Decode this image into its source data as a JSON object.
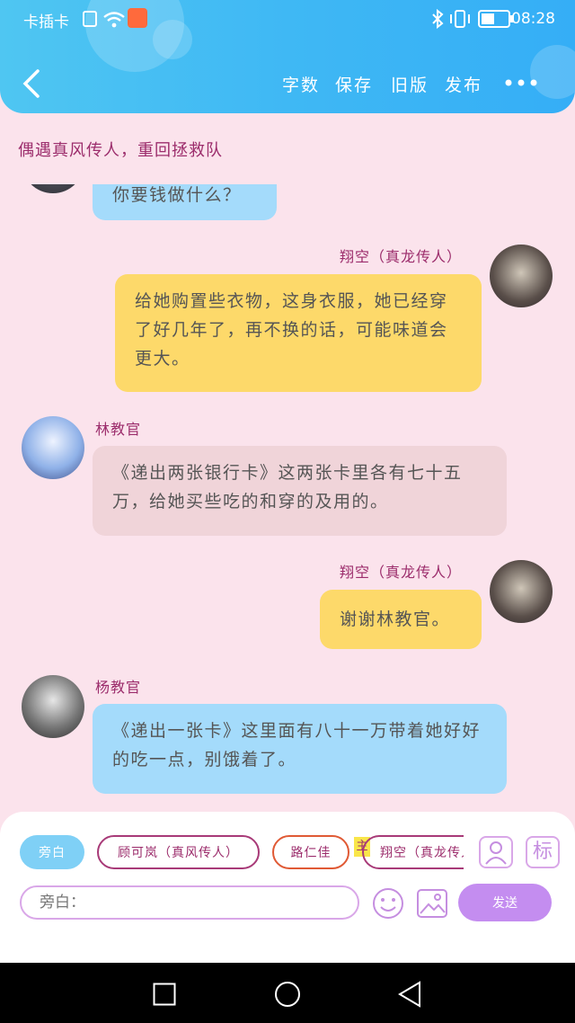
{
  "status": {
    "carrier": "卡插卡",
    "time": "08:28"
  },
  "header": {
    "actions": [
      "字数",
      "保存",
      "旧版",
      "发布"
    ]
  },
  "story": {
    "title": "偶遇真风传人，重回拯救队"
  },
  "messages": [
    {
      "name": "",
      "text": "你要钱做什么？"
    },
    {
      "name": "翔空（真龙传人）",
      "text": "给她购置些衣物，这身衣服，她已经穿了好几年了，再不换的话，可能味道会更大。"
    },
    {
      "name": "林教官",
      "text": "《递出两张银行卡》这两张卡里各有七十五万，给她买些吃的和穿的及用的。"
    },
    {
      "name": "翔空（真龙传人）",
      "text": "谢谢林教官。"
    },
    {
      "name": "杨教官",
      "text": "《递出一张卡》这里面有八十一万带着她好好的吃一点，别饿着了。"
    }
  ],
  "composer": {
    "chips": [
      "旁白",
      "顾可岚（真风传人）",
      "路仁佳",
      "翔空（真龙传人）"
    ],
    "main_tag": "主",
    "avatar_label": "标",
    "input_placeholder": "旁白：",
    "send_label": "发送"
  },
  "colors": {
    "accent": "#9c2d6c",
    "header": "#3fb8f4",
    "send": "#c48df0",
    "chip_active": "#7fd0f6"
  }
}
